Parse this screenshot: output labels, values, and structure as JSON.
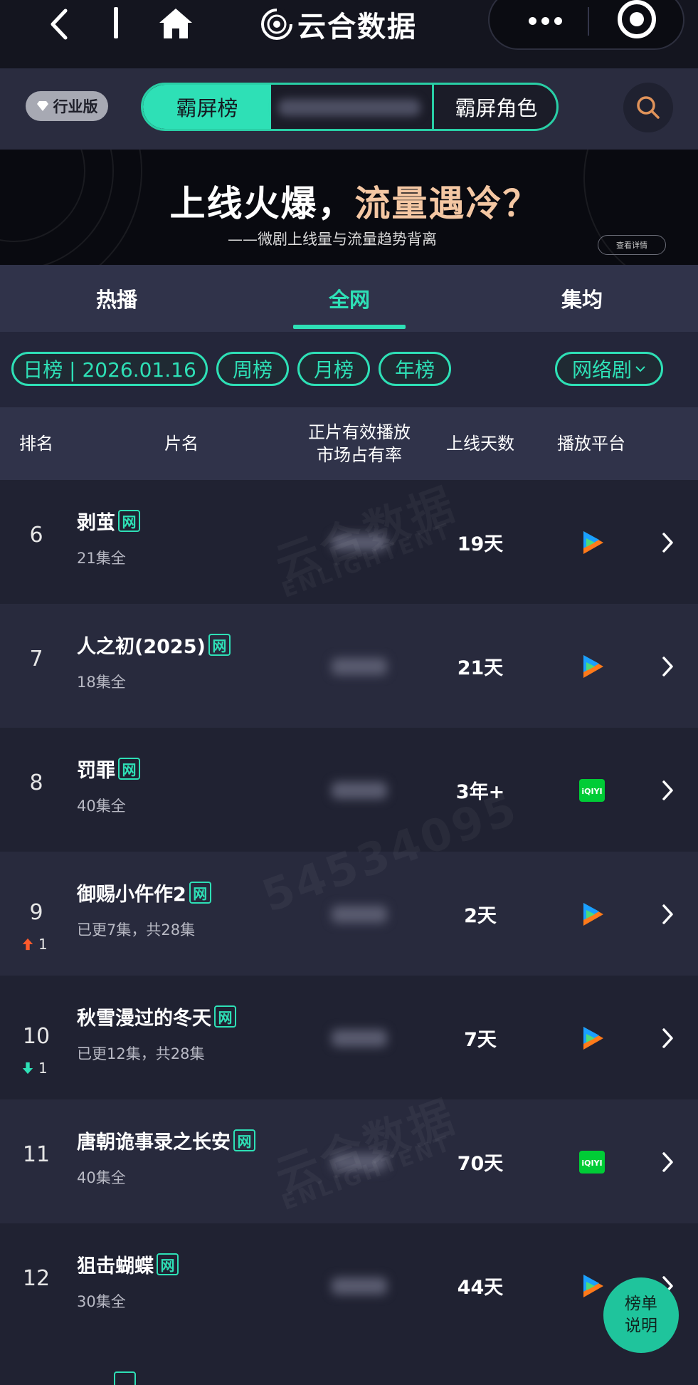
{
  "brand": {
    "name": "云合数据"
  },
  "header": {
    "edition_label": "行业版",
    "switch": {
      "active_label": "霸屏榜",
      "right_label": "霸屏角色"
    }
  },
  "banner": {
    "title_prefix": "上线火爆，",
    "title_highlight": "流量遇冷？",
    "subtitle": "——微剧上线量与流量趋势背离",
    "button_label": "查看详情"
  },
  "tabs": [
    {
      "label": "热播",
      "active": false
    },
    {
      "label": "全网",
      "active": true
    },
    {
      "label": "集均",
      "active": false
    }
  ],
  "filters": {
    "daily": "日榜 | 2026.01.16",
    "weekly": "周榜",
    "monthly": "月榜",
    "yearly": "年榜",
    "category": "网络剧"
  },
  "table_header": {
    "rank": "排名",
    "title": "片名",
    "share_line1": "正片有效播放",
    "share_line2": "市场占有率",
    "days": "上线天数",
    "platform": "播放平台"
  },
  "rows": [
    {
      "rank": "6",
      "title": "剥茧",
      "tag": "网",
      "episodes": "21集全",
      "days": "19天",
      "platform": "tencent-video"
    },
    {
      "rank": "7",
      "title": "人之初(2025)",
      "tag": "网",
      "episodes": "18集全",
      "days": "21天",
      "platform": "tencent-video"
    },
    {
      "rank": "8",
      "title": "罚罪",
      "tag": "网",
      "episodes": "40集全",
      "days": "3年+",
      "platform": "iqiyi"
    },
    {
      "rank": "9",
      "title": "御赐小仵作2",
      "tag": "网",
      "episodes": "已更7集，共28集",
      "days": "2天",
      "platform": "tencent-video",
      "trend": "up",
      "trend_value": "1"
    },
    {
      "rank": "10",
      "title": "秋雪漫过的冬天",
      "tag": "网",
      "episodes": "已更12集，共28集",
      "days": "7天",
      "platform": "tencent-video",
      "trend": "down",
      "trend_value": "1"
    },
    {
      "rank": "11",
      "title": "唐朝诡事录之长安",
      "tag": "网",
      "episodes": "40集全",
      "days": "70天",
      "platform": "iqiyi"
    },
    {
      "rank": "12",
      "title": "狙击蝴蝶",
      "tag": "网",
      "episodes": "30集全",
      "days": "44天",
      "platform": "tencent-video"
    }
  ],
  "watermark": {
    "brand_cn": "云合数据",
    "brand_en": "ENLIGHTENT",
    "user_id": "54534095"
  },
  "float_button": {
    "line1": "榜单",
    "line2": "说明"
  },
  "colors": {
    "accent": "#2ee0b6",
    "background": "#24263a",
    "trend_up": "#ff5a2c",
    "trend_down": "#2ee0b6"
  }
}
